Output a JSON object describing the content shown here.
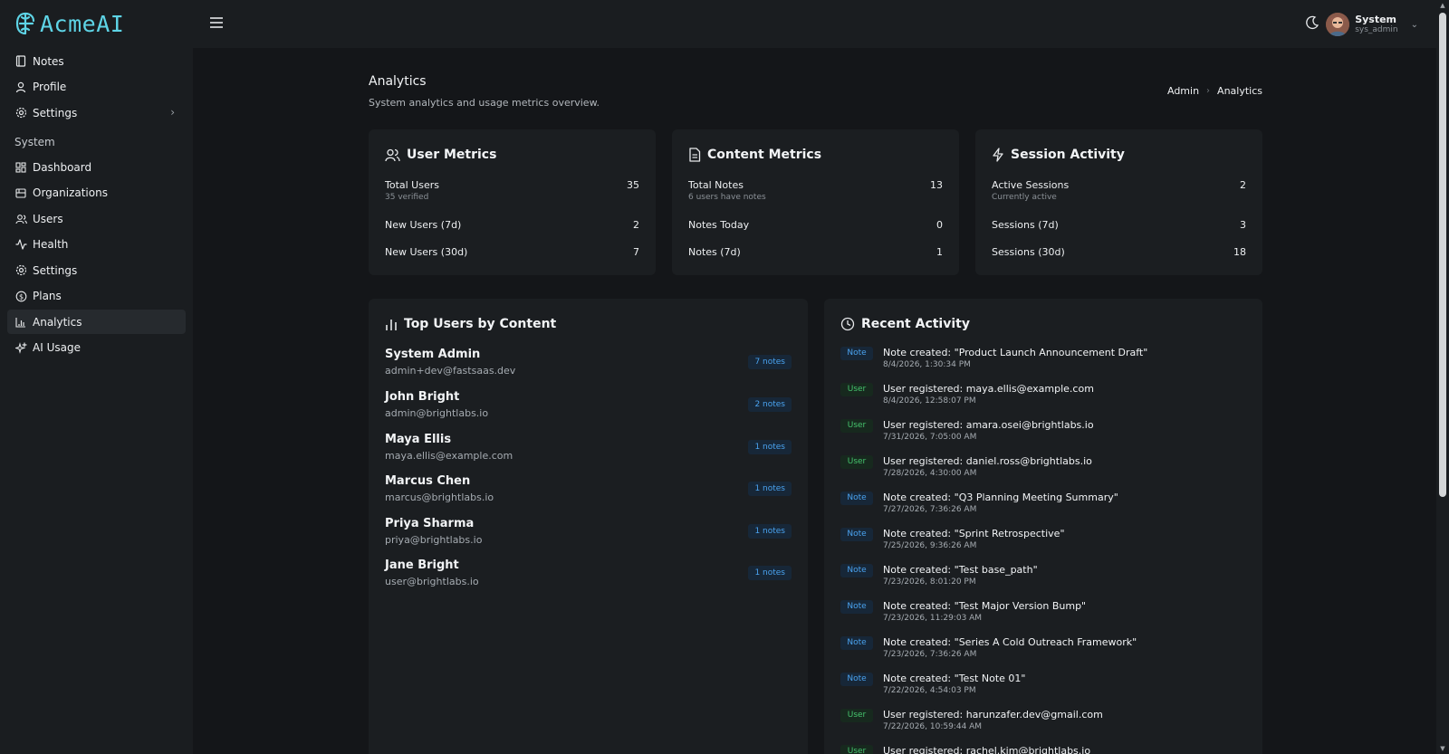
{
  "app": {
    "logo_text": "AcmeAI"
  },
  "sidebar": {
    "items": [
      {
        "label": "Notes",
        "icon": "notebook-icon"
      },
      {
        "label": "Profile",
        "icon": "user-icon"
      },
      {
        "label": "Settings",
        "icon": "gear-icon",
        "has_chevron": true
      }
    ],
    "section_label": "System",
    "system_items": [
      {
        "label": "Dashboard",
        "icon": "dashboard-icon"
      },
      {
        "label": "Organizations",
        "icon": "building-icon"
      },
      {
        "label": "Users",
        "icon": "users-icon"
      },
      {
        "label": "Health",
        "icon": "pulse-icon"
      },
      {
        "label": "Settings",
        "icon": "gear-icon"
      },
      {
        "label": "Plans",
        "icon": "dollar-icon"
      },
      {
        "label": "Analytics",
        "icon": "chart-icon",
        "active": true
      },
      {
        "label": "AI Usage",
        "icon": "sparkles-icon"
      }
    ]
  },
  "topbar": {
    "user_name": "System",
    "user_role": "sys_admin"
  },
  "page": {
    "title": "Analytics",
    "subtitle": "System analytics and usage metrics overview.",
    "breadcrumb": [
      "Admin",
      "Analytics"
    ]
  },
  "user_metrics": {
    "title": "User Metrics",
    "rows": [
      {
        "label": "Total Users",
        "sub": "35 verified",
        "value": "35"
      },
      {
        "label": "New Users (7d)",
        "value": "2"
      },
      {
        "label": "New Users (30d)",
        "value": "7"
      }
    ]
  },
  "content_metrics": {
    "title": "Content Metrics",
    "rows": [
      {
        "label": "Total Notes",
        "sub": "6 users have notes",
        "value": "13"
      },
      {
        "label": "Notes Today",
        "value": "0"
      },
      {
        "label": "Notes (7d)",
        "value": "1"
      }
    ]
  },
  "session_activity": {
    "title": "Session Activity",
    "rows": [
      {
        "label": "Active Sessions",
        "sub": "Currently active",
        "value": "2"
      },
      {
        "label": "Sessions (7d)",
        "value": "3"
      },
      {
        "label": "Sessions (30d)",
        "value": "18"
      }
    ]
  },
  "top_users": {
    "title": "Top Users by Content",
    "users": [
      {
        "name": "System Admin",
        "email": "admin+dev@fastsaas.dev",
        "notes": "7 notes"
      },
      {
        "name": "John Bright",
        "email": "admin@brightlabs.io",
        "notes": "2 notes"
      },
      {
        "name": "Maya Ellis",
        "email": "maya.ellis@example.com",
        "notes": "1 notes"
      },
      {
        "name": "Marcus Chen",
        "email": "marcus@brightlabs.io",
        "notes": "1 notes"
      },
      {
        "name": "Priya Sharma",
        "email": "priya@brightlabs.io",
        "notes": "1 notes"
      },
      {
        "name": "Jane Bright",
        "email": "user@brightlabs.io",
        "notes": "1 notes"
      }
    ]
  },
  "recent_activity": {
    "title": "Recent Activity",
    "items": [
      {
        "type": "Note",
        "text": "Note created: \"Product Launch Announcement Draft\"",
        "time": "8/4/2026, 1:30:34 PM"
      },
      {
        "type": "User",
        "text": "User registered: maya.ellis@example.com",
        "time": "8/4/2026, 12:58:07 PM"
      },
      {
        "type": "User",
        "text": "User registered: amara.osei@brightlabs.io",
        "time": "7/31/2026, 7:05:00 AM"
      },
      {
        "type": "User",
        "text": "User registered: daniel.ross@brightlabs.io",
        "time": "7/28/2026, 4:30:00 AM"
      },
      {
        "type": "Note",
        "text": "Note created: \"Q3 Planning Meeting Summary\"",
        "time": "7/27/2026, 7:36:26 AM"
      },
      {
        "type": "Note",
        "text": "Note created: \"Sprint Retrospective\"",
        "time": "7/25/2026, 9:36:26 AM"
      },
      {
        "type": "Note",
        "text": "Note created: \"Test base_path\"",
        "time": "7/23/2026, 8:01:20 PM"
      },
      {
        "type": "Note",
        "text": "Note created: \"Test Major Version Bump\"",
        "time": "7/23/2026, 11:29:03 AM"
      },
      {
        "type": "Note",
        "text": "Note created: \"Series A Cold Outreach Framework\"",
        "time": "7/23/2026, 7:36:26 AM"
      },
      {
        "type": "Note",
        "text": "Note created: \"Test Note 01\"",
        "time": "7/22/2026, 4:54:03 PM"
      },
      {
        "type": "User",
        "text": "User registered: harunzafer.dev@gmail.com",
        "time": "7/22/2026, 10:59:44 AM"
      },
      {
        "type": "User",
        "text": "User registered: rachel.kim@brightlabs.io",
        "time": ""
      }
    ]
  },
  "colors": {
    "accent": "#5ed4e6",
    "note_badge": "#4aa3f0",
    "user_badge": "#45c46d"
  }
}
